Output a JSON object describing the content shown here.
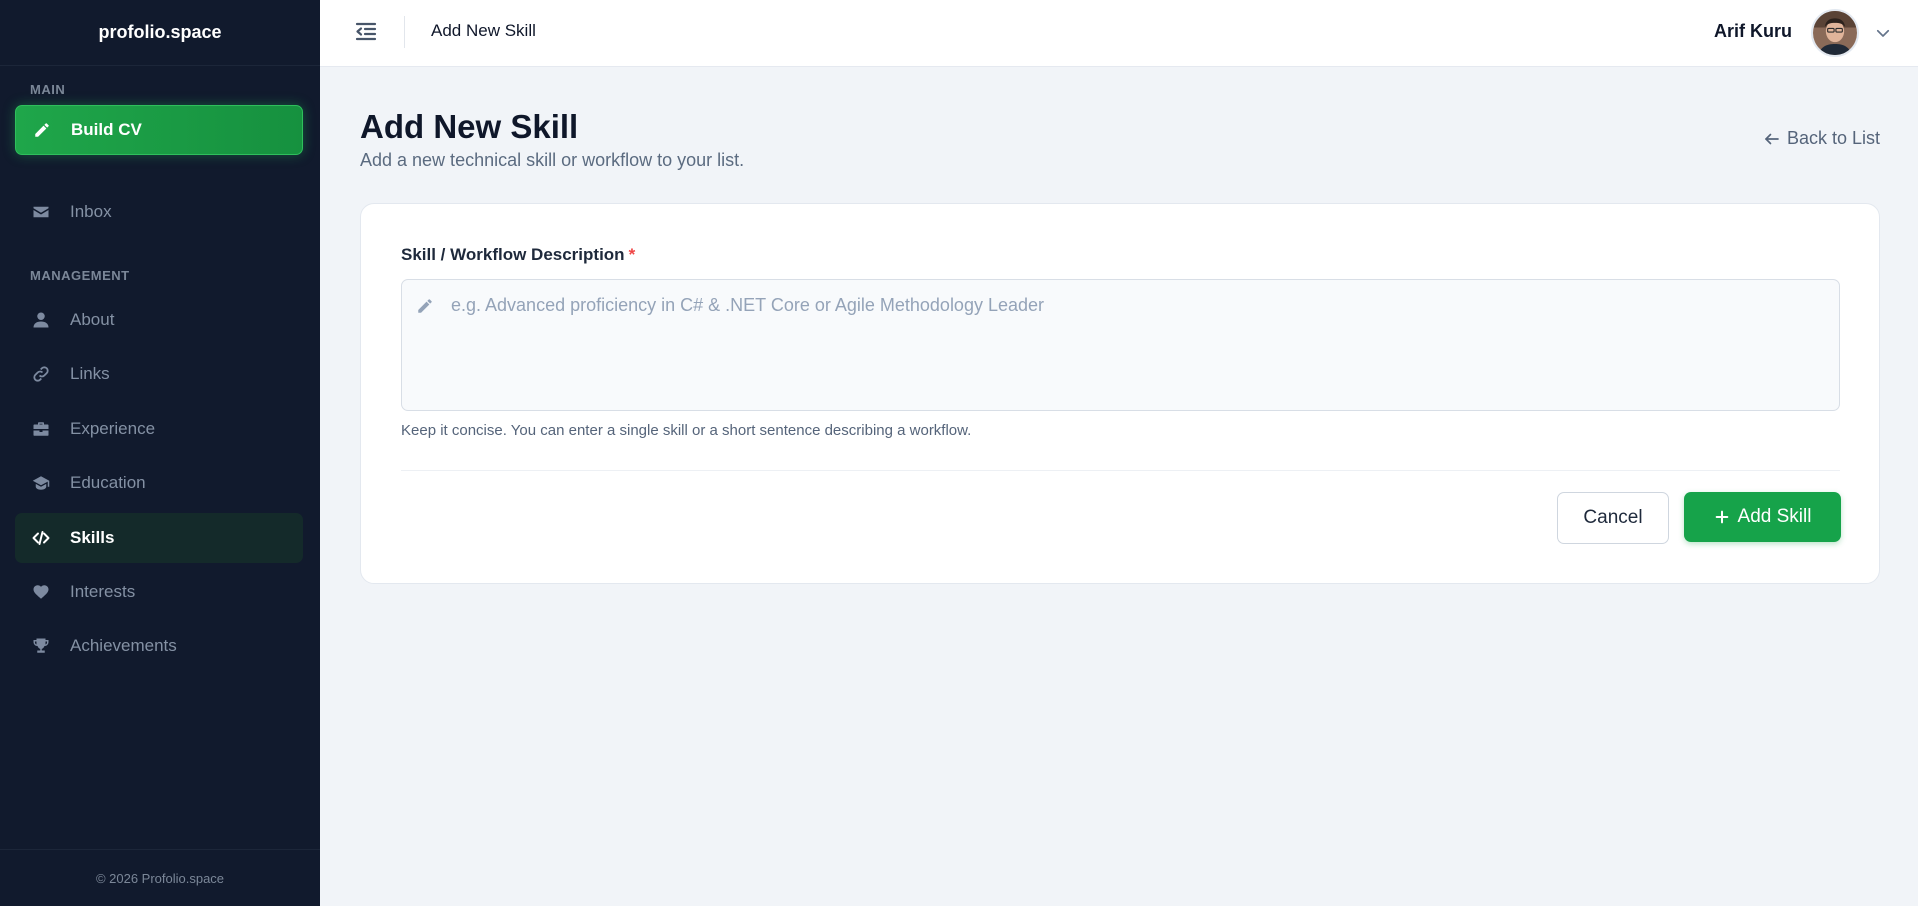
{
  "sidebar": {
    "brand": "profolio.space",
    "section_main": "MAIN",
    "section_management": "MANAGEMENT",
    "items": [
      {
        "label": "Build CV",
        "icon": "pencil-icon"
      },
      {
        "label": "Inbox",
        "icon": "envelope-icon"
      },
      {
        "label": "About",
        "icon": "user-icon"
      },
      {
        "label": "Links",
        "icon": "link-icon"
      },
      {
        "label": "Experience",
        "icon": "briefcase-icon"
      },
      {
        "label": "Education",
        "icon": "graduation-cap-icon"
      },
      {
        "label": "Skills",
        "icon": "code-icon"
      },
      {
        "label": "Interests",
        "icon": "heart-icon"
      },
      {
        "label": "Achievements",
        "icon": "trophy-icon"
      }
    ],
    "footer": "© 2026 Profolio.space"
  },
  "topbar": {
    "title": "Add New Skill",
    "user_name": "Arif Kuru"
  },
  "page": {
    "title": "Add New Skill",
    "subtitle": "Add a new technical skill or workflow to your list.",
    "back_label": "Back to List"
  },
  "form": {
    "label": "Skill / Workflow Description",
    "required_mark": "*",
    "placeholder": "e.g. Advanced proficiency in C# & .NET Core or Agile Methodology Leader",
    "value": "",
    "help": "Keep it concise. You can enter a single skill or a short sentence describing a workflow.",
    "cancel_label": "Cancel",
    "submit_label": "Add Skill"
  },
  "colors": {
    "sidebar_bg": "#111a2d",
    "accent_green": "#16a34a",
    "active_item_bg": "#142a2a",
    "page_bg": "#f1f4f8",
    "required": "#ef4444"
  }
}
